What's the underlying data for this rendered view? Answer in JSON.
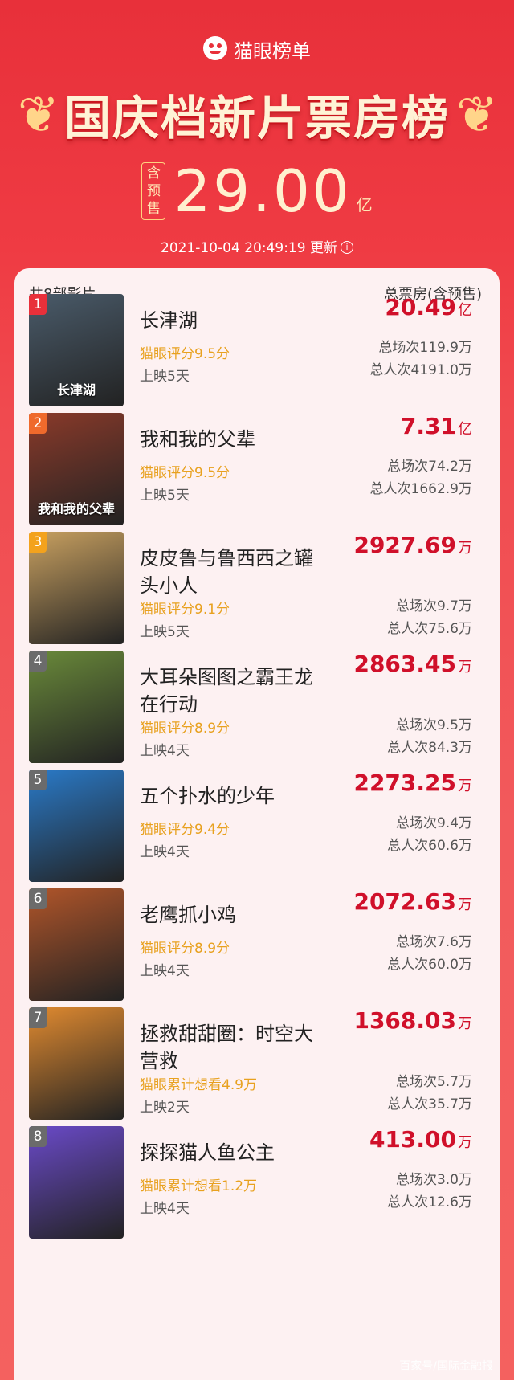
{
  "header": {
    "brand": "猫眼榜单",
    "title": "国庆档新片票房榜",
    "presale_tag": "含预售",
    "total": "29.00",
    "total_unit": "亿",
    "updated": "2021-10-04 20:49:19 更新"
  },
  "list": {
    "count_label": "共8部影片",
    "box_header": "总票房(含预售)",
    "films": [
      {
        "rank": "1",
        "name": "长津湖",
        "poster_text": "长津湖",
        "rating": "猫眼评分9.5分",
        "days": "上映5天",
        "box": "20.49",
        "unit": "亿",
        "shows": "总场次119.9万",
        "people": "总人次4191.0万",
        "rank_color": "#e8303a",
        "poster_color": "#4a5b6a"
      },
      {
        "rank": "2",
        "name": "我和我的父辈",
        "poster_text": "我和我的父辈",
        "rating": "猫眼评分9.5分",
        "days": "上映5天",
        "box": "7.31",
        "unit": "亿",
        "shows": "总场次74.2万",
        "people": "总人次1662.9万",
        "rank_color": "#ef6a2c",
        "poster_color": "#8a3a2a"
      },
      {
        "rank": "3",
        "name": "皮皮鲁与鲁西西之罐头小人",
        "poster_text": "",
        "rating": "猫眼评分9.1分",
        "days": "上映5天",
        "box": "2927.69",
        "unit": "万",
        "shows": "总场次9.7万",
        "people": "总人次75.6万",
        "rank_color": "#f3a21d",
        "poster_color": "#c8a060"
      },
      {
        "rank": "4",
        "name": "大耳朵图图之霸王龙在行动",
        "poster_text": "",
        "rating": "猫眼评分8.9分",
        "days": "上映4天",
        "box": "2863.45",
        "unit": "万",
        "shows": "总场次9.5万",
        "people": "总人次84.3万",
        "rank_color": "#6b6b6b",
        "poster_color": "#6a8a3a"
      },
      {
        "rank": "5",
        "name": "五个扑水的少年",
        "poster_text": "",
        "rating": "猫眼评分9.4分",
        "days": "上映4天",
        "box": "2273.25",
        "unit": "万",
        "shows": "总场次9.4万",
        "people": "总人次60.6万",
        "rank_color": "#6b6b6b",
        "poster_color": "#2a7ac8"
      },
      {
        "rank": "6",
        "name": "老鹰抓小鸡",
        "poster_text": "",
        "rating": "猫眼评分8.9分",
        "days": "上映4天",
        "box": "2072.63",
        "unit": "万",
        "shows": "总场次7.6万",
        "people": "总人次60.0万",
        "rank_color": "#6b6b6b",
        "poster_color": "#b0552a"
      },
      {
        "rank": "7",
        "name": "拯救甜甜圈：时空大营救",
        "poster_text": "",
        "rating": "猫眼累计想看4.9万",
        "days": "上映2天",
        "box": "1368.03",
        "unit": "万",
        "shows": "总场次5.7万",
        "people": "总人次35.7万",
        "rank_color": "#6b6b6b",
        "poster_color": "#e08a30"
      },
      {
        "rank": "8",
        "name": "探探猫人鱼公主",
        "poster_text": "",
        "rating": "猫眼累计想看1.2万",
        "days": "上映4天",
        "box": "413.00",
        "unit": "万",
        "shows": "总场次3.0万",
        "people": "总人次12.6万",
        "rank_color": "#6b6b6b",
        "poster_color": "#6a4ac8"
      }
    ]
  },
  "watermark": "百家号/国际金融报"
}
